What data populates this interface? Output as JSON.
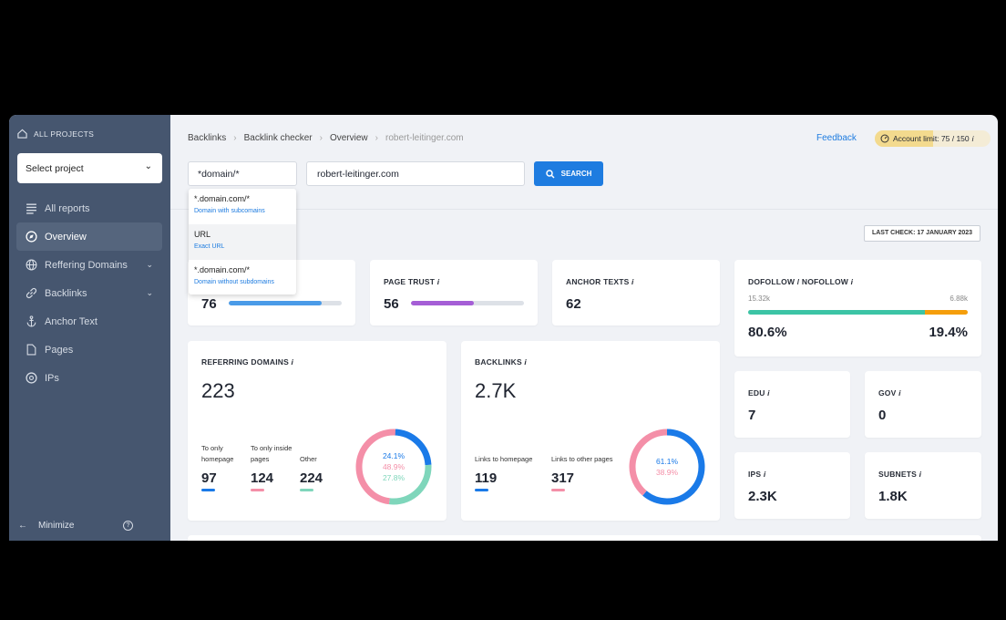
{
  "sidebar": {
    "all_projects": "ALL PROJECTS",
    "select_project": "Select project",
    "items": [
      {
        "label": "All reports",
        "icon": "list-icon"
      },
      {
        "label": "Overview",
        "icon": "compass-icon",
        "active": true
      },
      {
        "label": "Reffering Domains",
        "icon": "globe-icon",
        "expandable": true
      },
      {
        "label": "Backlinks",
        "icon": "link-icon",
        "expandable": true
      },
      {
        "label": "Anchor Text",
        "icon": "anchor-icon"
      },
      {
        "label": "Pages",
        "icon": "page-icon"
      },
      {
        "label": "IPs",
        "icon": "target-icon"
      }
    ],
    "minimize": "Minimize"
  },
  "breadcrumb": [
    "Backlinks",
    "Backlink checker",
    "Overview",
    "robert-leitinger.com"
  ],
  "header": {
    "feedback": "Feedback",
    "account_limit": "Account limit: 75 / 150",
    "account_limit_used": 0.5
  },
  "search": {
    "mode": "*domain/*",
    "query": "robert-leitinger.com",
    "button": "SEARCH",
    "options": [
      {
        "title": "*.domain.com/*",
        "desc": "Domain with subcomains"
      },
      {
        "title": "URL",
        "desc": "Exact URL"
      },
      {
        "title": "*.domain.com/*",
        "desc": "Domain without subdomains"
      }
    ]
  },
  "last_check": "LAST CHECK: 17 JANUARY 2023",
  "metrics": {
    "trust1": {
      "value": "76",
      "bar": 0.82,
      "color": "#4a9be8"
    },
    "page_trust": {
      "label": "PAGE TRUST",
      "value": "56",
      "bar": 0.56,
      "color": "#a55ed6"
    },
    "anchor_texts": {
      "label": "ANCHOR TEXTS",
      "value": "62"
    },
    "dofollow": {
      "label": "DOFOLLOW / NOFOLLOW",
      "do_count": "15.32k",
      "no_count": "6.88k",
      "do_pct": "80.6%",
      "no_pct": "19.4%",
      "do_share": 0.806,
      "do_color": "#3cc4a5",
      "no_color": "#f59e0b"
    },
    "referring_domains": {
      "label": "REFERRING DOMAINS",
      "value": "223",
      "breakdown": [
        {
          "label": "To only homepage",
          "value": "97",
          "color": "#1a7ae8",
          "pct": "24.1%",
          "share": 24.1
        },
        {
          "label": "To only inside pages",
          "value": "124",
          "color": "#f48fa8",
          "pct": "48.9%",
          "share": 48.9
        },
        {
          "label": "Other",
          "value": "224",
          "color": "#7fd6bb",
          "pct": "27.8%",
          "share": 27.8
        }
      ]
    },
    "backlinks": {
      "label": "BACKLINKS",
      "value": "2.7K",
      "breakdown": [
        {
          "label": "Links to homepage",
          "value": "119",
          "color": "#1a7ae8",
          "pct": "61.1%",
          "share": 61.1
        },
        {
          "label": "Links to other pages",
          "value": "317",
          "color": "#f48fa8",
          "pct": "38.9%",
          "share": 38.9
        }
      ]
    },
    "edu": {
      "label": "EDU",
      "value": "7"
    },
    "gov": {
      "label": "GOV",
      "value": "0"
    },
    "ips": {
      "label": "IPS",
      "value": "2.3K"
    },
    "subnets": {
      "label": "SUBNETS",
      "value": "1.8K"
    }
  }
}
